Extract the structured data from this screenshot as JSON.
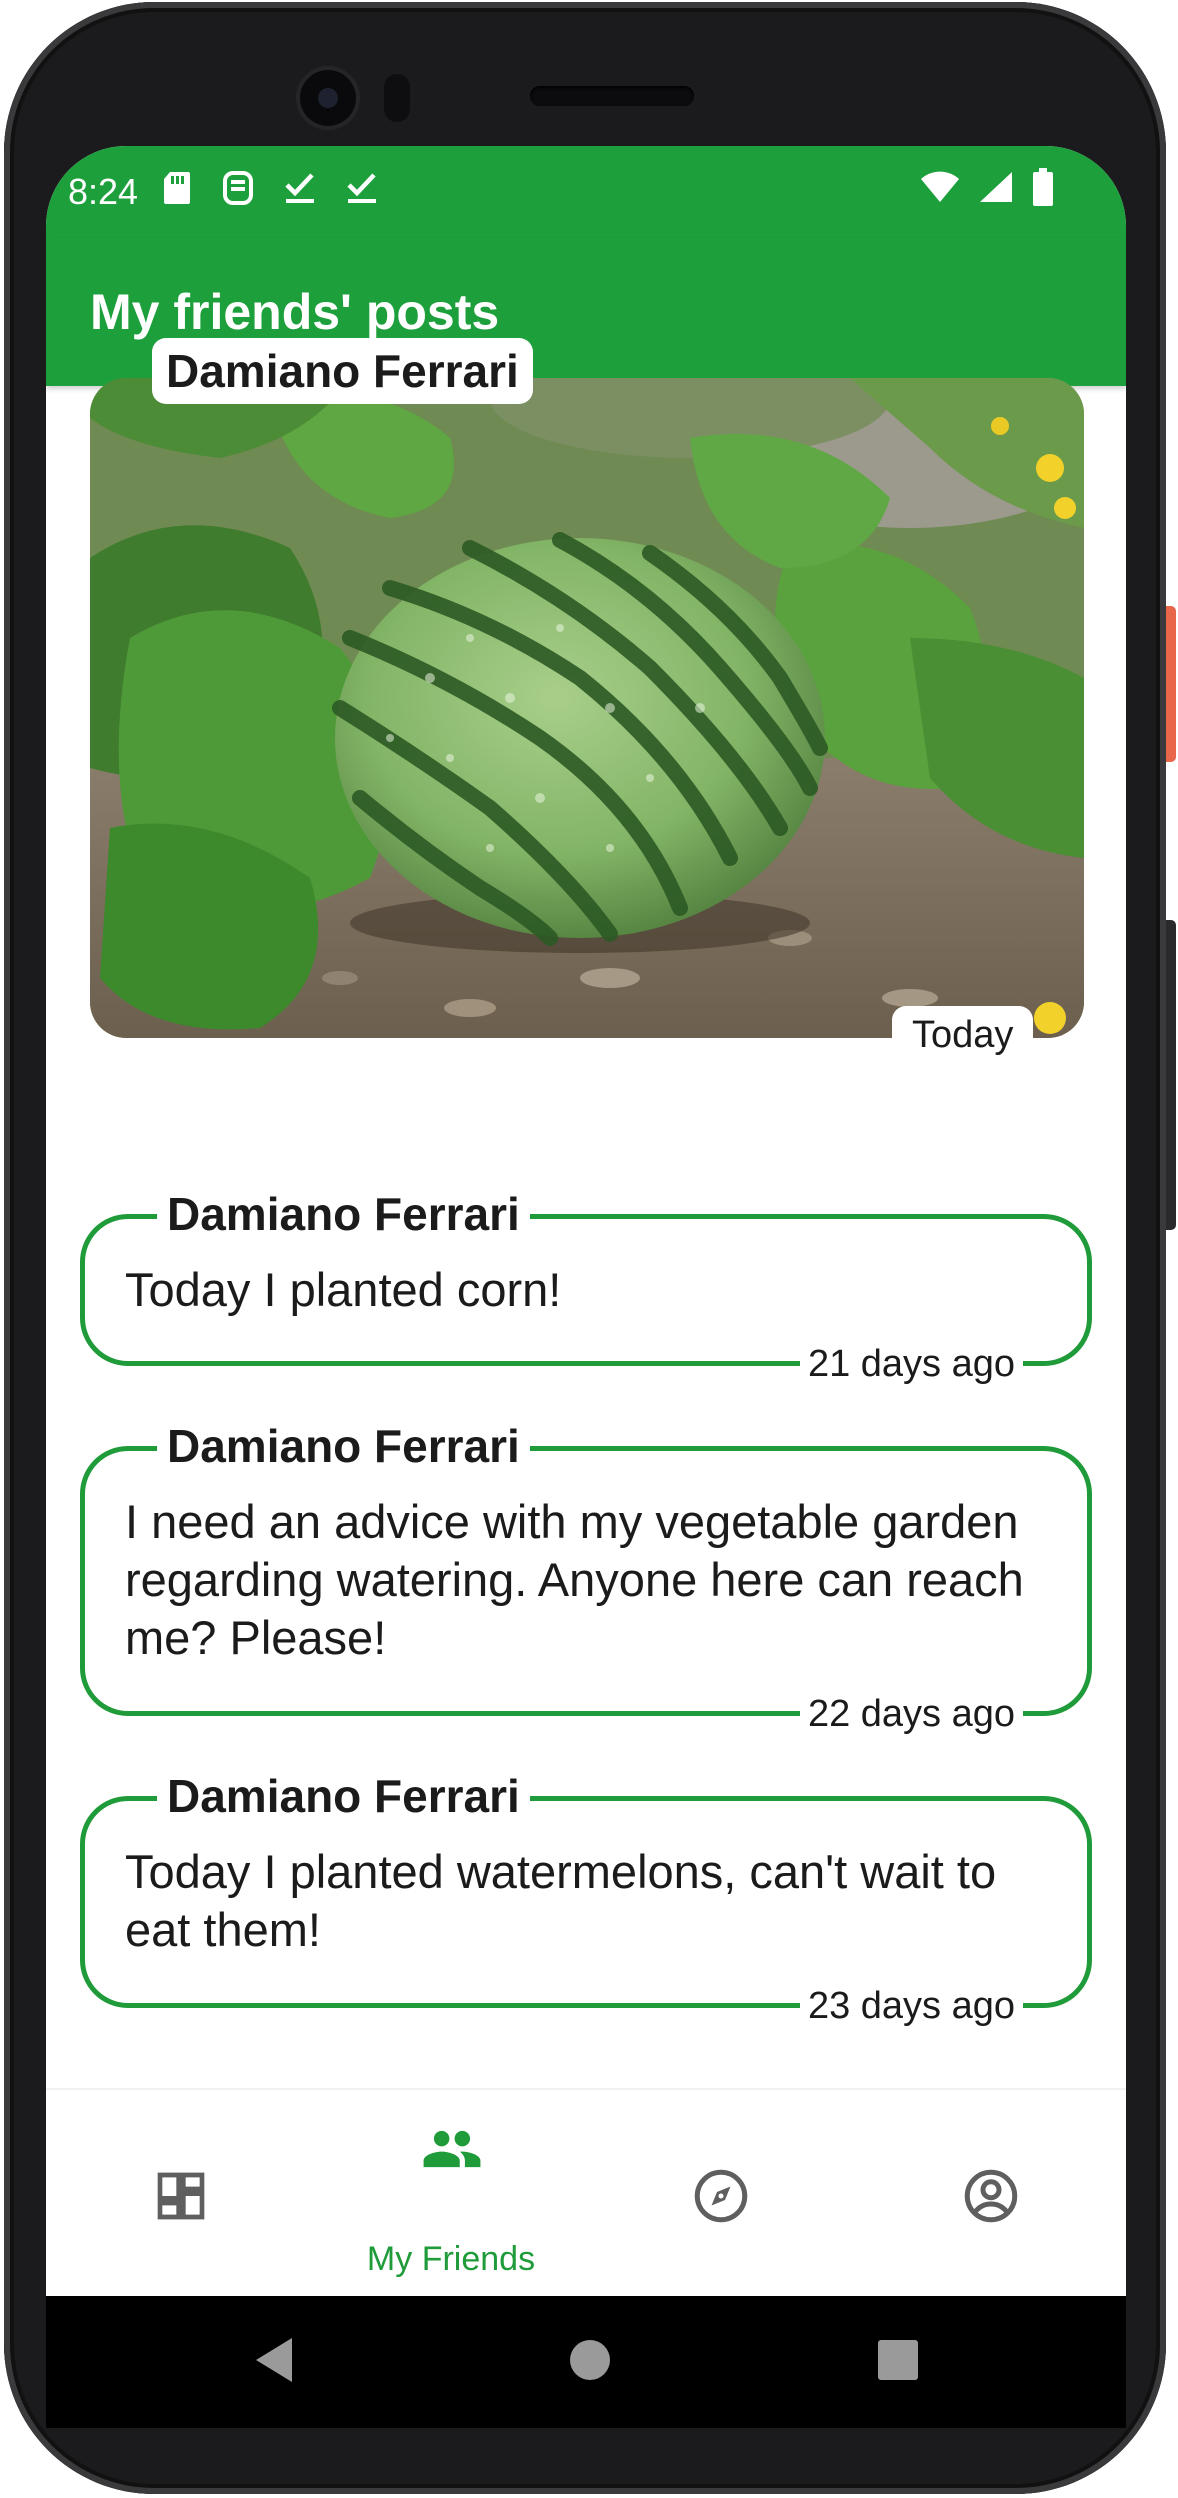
{
  "status_bar": {
    "time": "8:24",
    "left_icons": [
      "sd-card-icon",
      "sim-icon",
      "checkmark-icon",
      "checkmark-icon"
    ],
    "right_icons": [
      "wifi-icon",
      "signal-icon",
      "battery-icon"
    ]
  },
  "app_bar": {
    "title": "My friends' posts"
  },
  "posts": [
    {
      "type": "image",
      "author": "Damiano Ferrari",
      "date": "Today",
      "image": "watermelon-photo"
    },
    {
      "type": "text",
      "author": "Damiano Ferrari",
      "text": "Today I planted corn!",
      "date": "21 days ago"
    },
    {
      "type": "text",
      "author": "Damiano Ferrari",
      "text": "I need an advice with my vegetable garden regarding watering. Anyone here can reach me? Please!",
      "date": "22 days ago"
    },
    {
      "type": "text",
      "author": "Damiano Ferrari",
      "text": "Today I planted watermelons, can't wait to eat them!",
      "date": "23 days ago"
    }
  ],
  "bottom_nav": {
    "items": [
      {
        "icon": "dashboard-icon",
        "label": ""
      },
      {
        "icon": "people-icon",
        "label": "My Friends",
        "active": true
      },
      {
        "icon": "compass-icon",
        "label": ""
      },
      {
        "icon": "account-circle-icon",
        "label": ""
      }
    ]
  },
  "colors": {
    "primary": "#1da03c",
    "outline": "#1f9b3a",
    "text": "#1b1b1b",
    "icon_inactive": "#5f5f5f"
  }
}
